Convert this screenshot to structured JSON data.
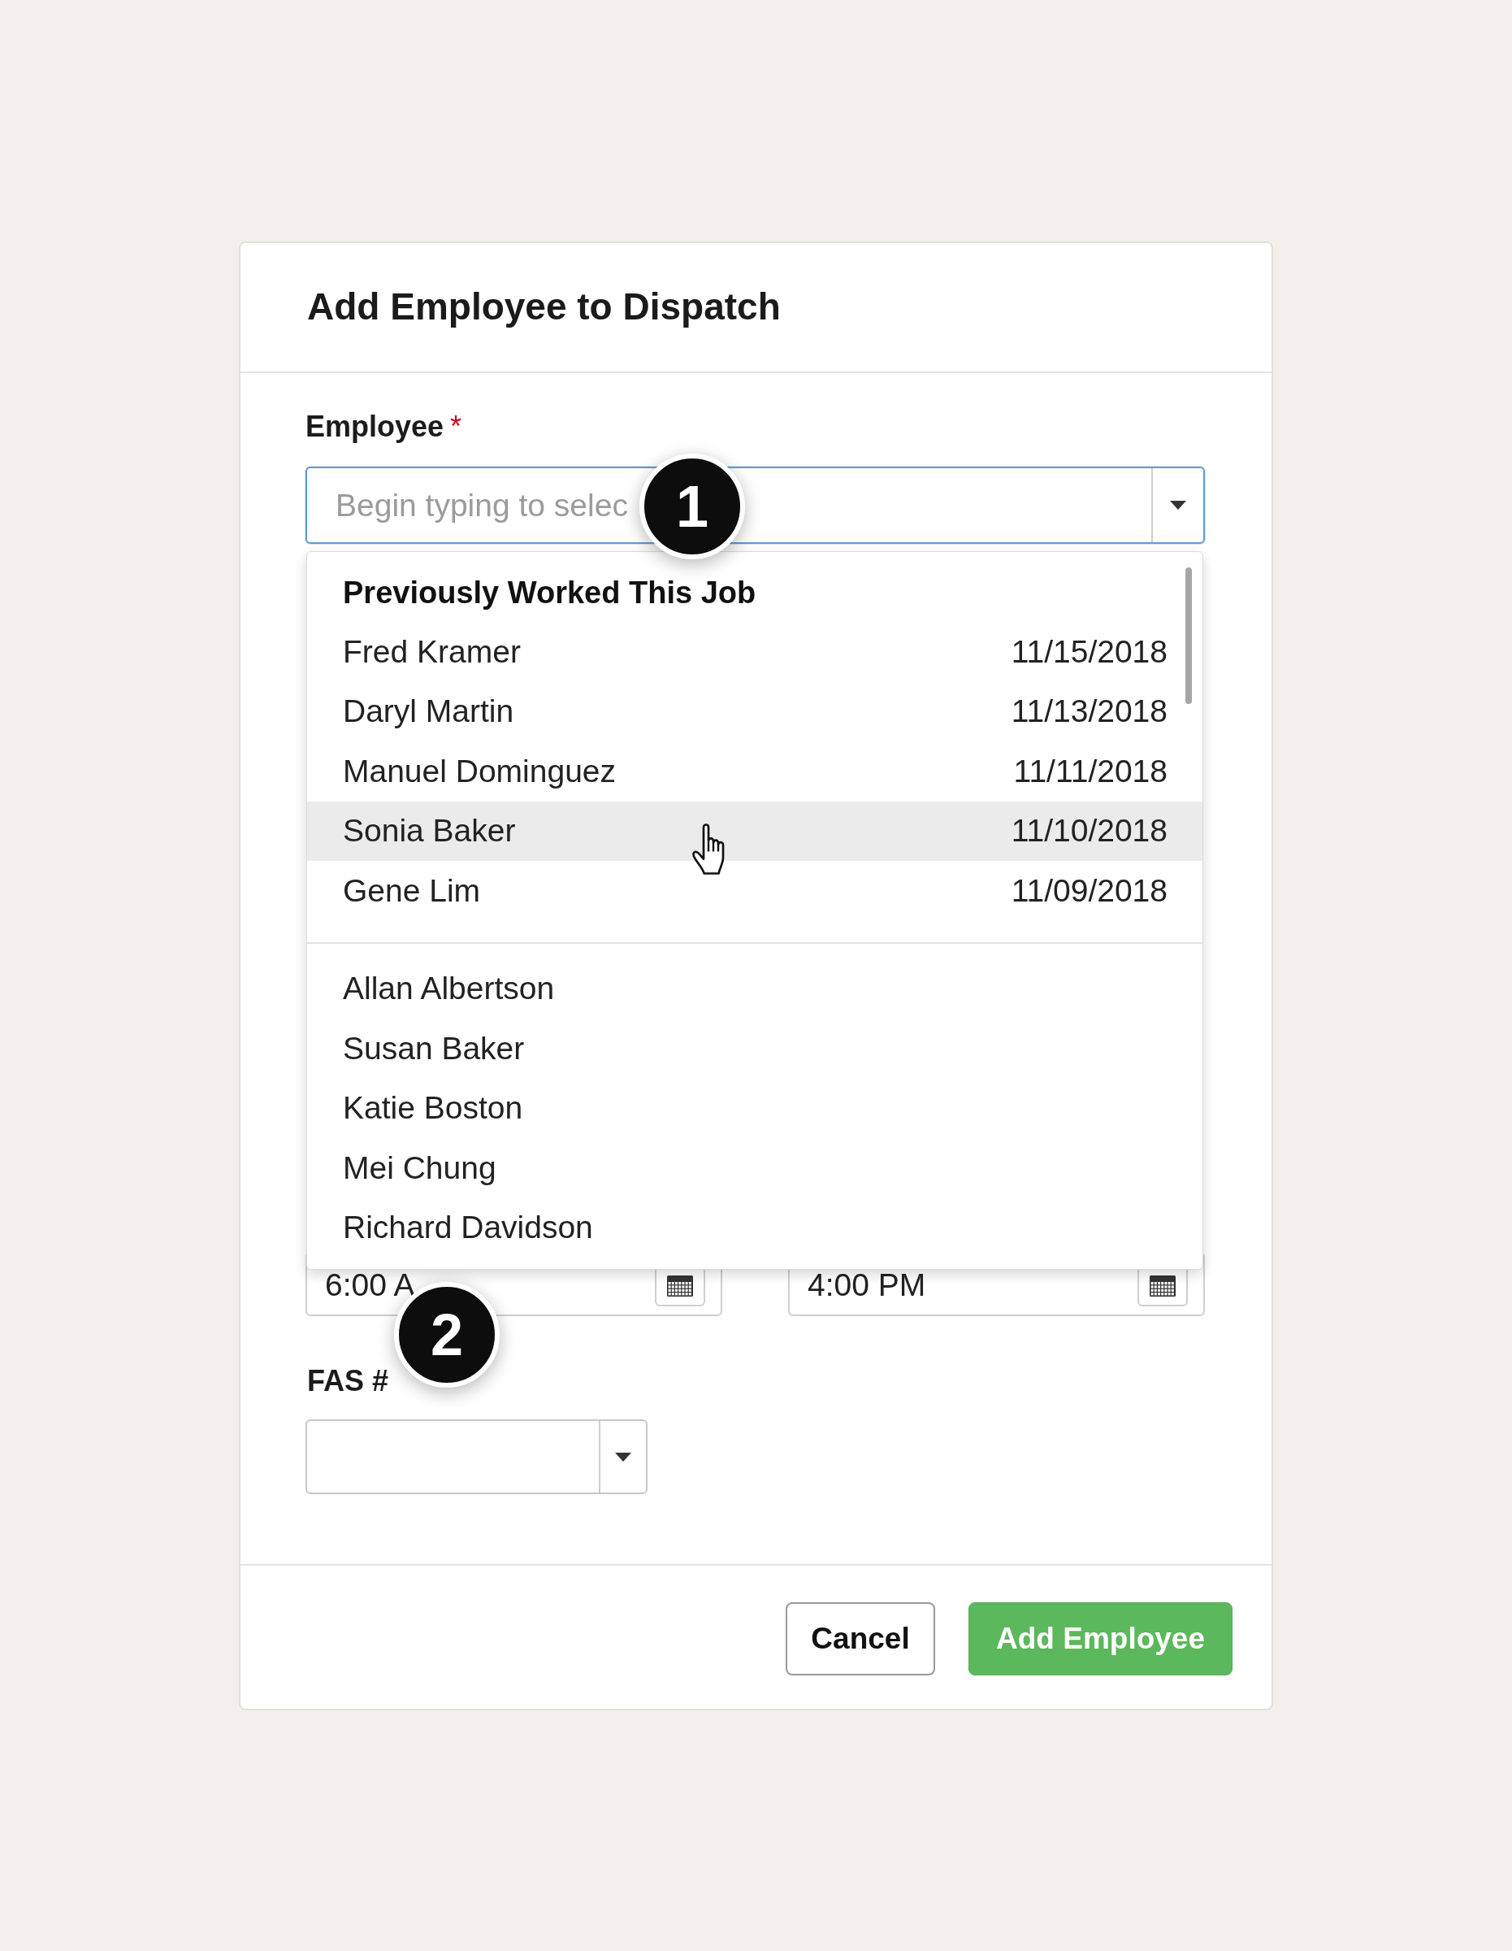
{
  "dialog": {
    "title": "Add Employee to Dispatch"
  },
  "employee_field": {
    "label": "Employee",
    "required_mark": "*",
    "placeholder": "Begin typing to selec",
    "focused": true,
    "callout": "1"
  },
  "employee_dropdown": {
    "groups": [
      {
        "heading": "Previously Worked This Job",
        "items": [
          {
            "name": "Fred Kramer",
            "date": "11/15/2018",
            "highlighted": false
          },
          {
            "name": "Daryl Martin",
            "date": "11/13/2018",
            "highlighted": false
          },
          {
            "name": "Manuel Dominguez",
            "date": "11/11/2018",
            "highlighted": false
          },
          {
            "name": "Sonia Baker",
            "date": "11/10/2018",
            "highlighted": true
          },
          {
            "name": "Gene Lim",
            "date": "11/09/2018",
            "highlighted": false
          }
        ]
      },
      {
        "items": [
          {
            "name": "Allan Albertson",
            "highlighted": false
          },
          {
            "name": "Susan Baker",
            "highlighted": false
          },
          {
            "name": "Katie Boston",
            "highlighted": false
          },
          {
            "name": "Mei Chung",
            "highlighted": false
          },
          {
            "name": "Richard Davidson",
            "highlighted": false
          }
        ]
      }
    ]
  },
  "time_fields": [
    {
      "value": "6:00 A"
    },
    {
      "value": "4:00 PM"
    }
  ],
  "fas_field": {
    "label": "FAS #",
    "callout": "2"
  },
  "buttons": [
    {
      "label": "Cancel",
      "kind": "secondary"
    },
    {
      "label": "Add Employee",
      "kind": "primary"
    }
  ]
}
